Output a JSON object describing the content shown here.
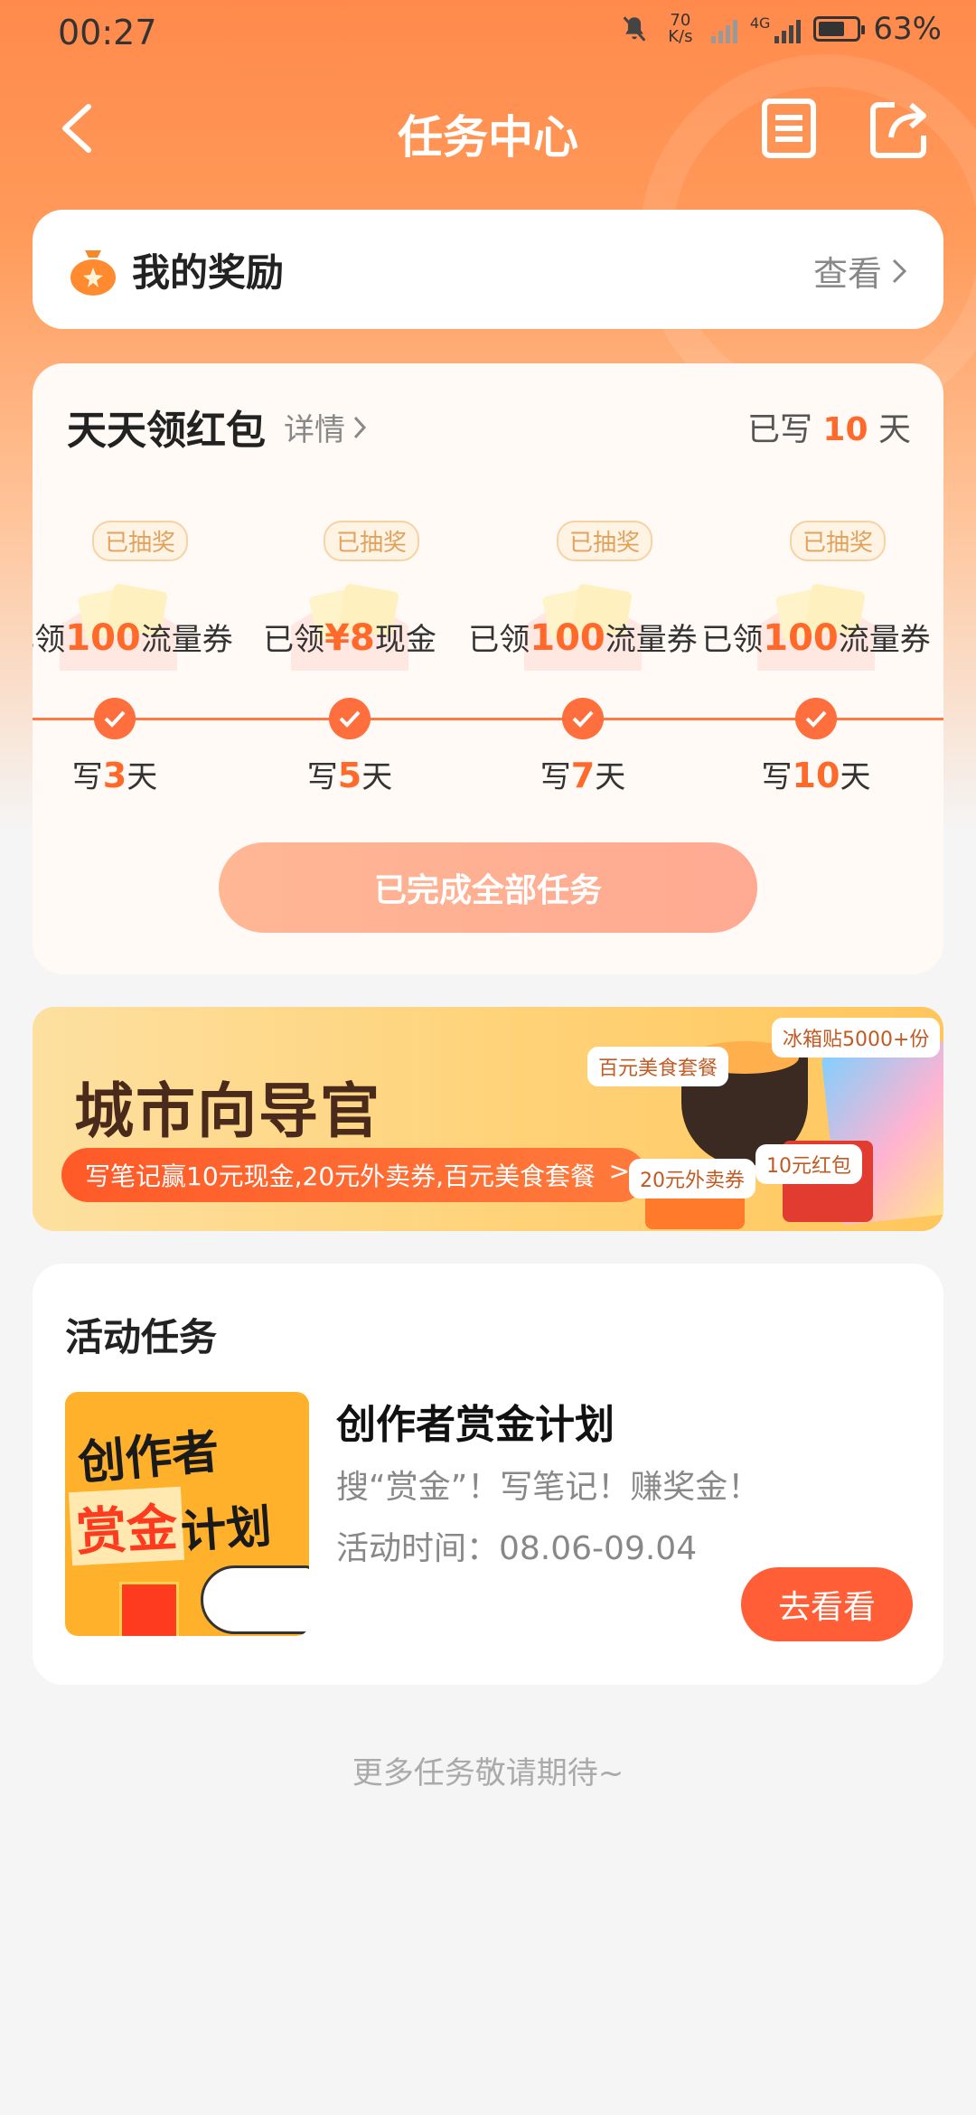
{
  "status_bar": {
    "time": "00:27",
    "net_speed_value": "70",
    "net_speed_unit": "K/s",
    "network_type": "4G",
    "battery": "63%",
    "icons": [
      "mute-icon",
      "no-signal-icon",
      "signal-4g-icon",
      "battery-icon"
    ]
  },
  "nav": {
    "title": "任务中心",
    "icons": [
      "back-arrow-icon",
      "document-list-icon",
      "share-icon"
    ]
  },
  "rewards": {
    "label": "我的奖励",
    "action": "查看"
  },
  "daily": {
    "title": "天天领红包",
    "detail": "详情",
    "written_prefix": "已写",
    "written_days": "10",
    "written_suffix": "天",
    "milestones": [
      {
        "tag": "已抽奖",
        "prize_pre": "已领",
        "prize_val": "100",
        "prize_post": "流量券",
        "day_pre": "写",
        "day_num": "3",
        "day_post": "天"
      },
      {
        "tag": "已抽奖",
        "prize_pre": "已领",
        "prize_val": "¥8",
        "prize_post": "现金",
        "day_pre": "写",
        "day_num": "5",
        "day_post": "天"
      },
      {
        "tag": "已抽奖",
        "prize_pre": "已领",
        "prize_val": "100",
        "prize_post": "流量券",
        "day_pre": "写",
        "day_num": "7",
        "day_post": "天"
      },
      {
        "tag": "已抽奖",
        "prize_pre": "已领",
        "prize_val": "100",
        "prize_post": "流量券",
        "day_pre": "写",
        "day_num": "10",
        "day_post": "天"
      }
    ],
    "button": "已完成全部任务"
  },
  "banner": {
    "title": "城市向导官",
    "subtitle": "写笔记赢10元现金,20元外卖券,百元美食套餐",
    "stickers": [
      "百元美食套餐",
      "冰箱贴5000+份",
      "20元外卖券",
      "10元红包"
    ]
  },
  "activity": {
    "section_title": "活动任务",
    "thumb_line1": "创作者",
    "thumb_line2": "赏金",
    "thumb_line3": "计划",
    "name": "创作者赏金计划",
    "desc": "搜“赏金”！写笔记！赚奖金！",
    "time": "活动时间：08.06-09.04",
    "button": "去看看"
  },
  "footer": {
    "more": "更多任务敬请期待~"
  },
  "colors": {
    "accent": "#ff6a2b",
    "button": "#ff5e36"
  }
}
